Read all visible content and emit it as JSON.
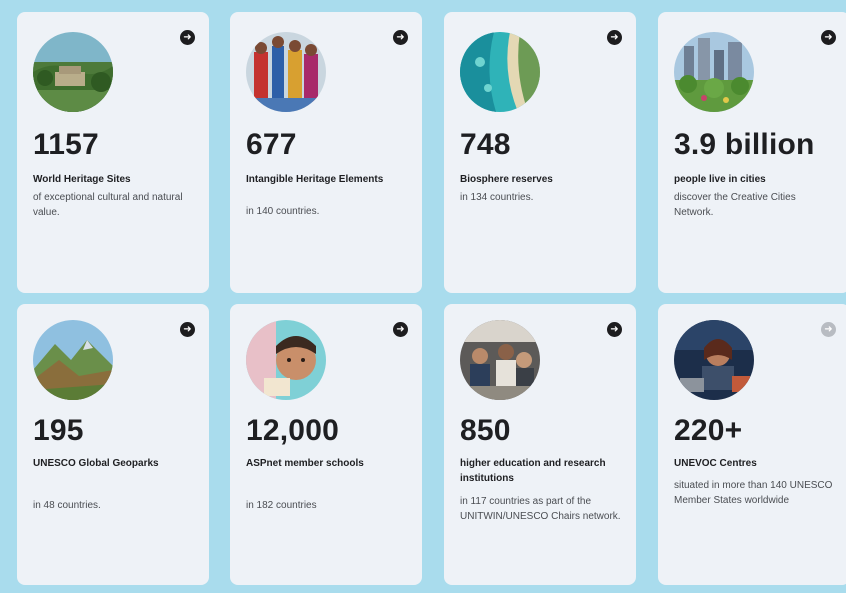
{
  "cards": [
    {
      "number": "1157",
      "label": "World Heritage Sites",
      "desc": "of exceptional cultural and natural value.",
      "arrow": "arrow-right-icon",
      "image": "heritage-site-photo"
    },
    {
      "number": "677",
      "label": "Intangible Heritage Elements",
      "desc": "in 140 countries.",
      "arrow": "arrow-right-icon",
      "image": "intangible-heritage-photo"
    },
    {
      "number": "748",
      "label": "Biosphere reserves",
      "desc": "in 134 countries.",
      "arrow": "arrow-right-icon",
      "image": "biosphere-reserve-photo"
    },
    {
      "number": "3.9 billion",
      "label": "people live in cities",
      "desc": "discover the Creative Cities Network.",
      "arrow": "arrow-right-icon",
      "image": "creative-city-photo"
    },
    {
      "number": "195",
      "label": "UNESCO Global Geoparks",
      "desc": "in 48 countries.",
      "arrow": "arrow-right-icon",
      "image": "geopark-photo"
    },
    {
      "number": "12,000",
      "label": "ASPnet member schools",
      "desc": "in 182 countries",
      "arrow": "arrow-right-icon",
      "image": "school-child-photo"
    },
    {
      "number": "850",
      "label": "higher education and research institutions",
      "desc": "in 117 countries as part of the UNITWIN/UNESCO Chairs network.",
      "arrow": "arrow-right-icon",
      "image": "research-lab-photo"
    },
    {
      "number": "220+",
      "label": "UNEVOC Centres",
      "desc": "situated in more than 140 UNESCO Member States worldwide",
      "arrow": "arrow-right-icon",
      "image": "vocational-training-photo"
    }
  ],
  "colors": {
    "page_background": "#a9dced",
    "card_background": "#eef2f7",
    "arrow_active": "#1d1d1f",
    "arrow_dim": "#b8bcc2"
  }
}
